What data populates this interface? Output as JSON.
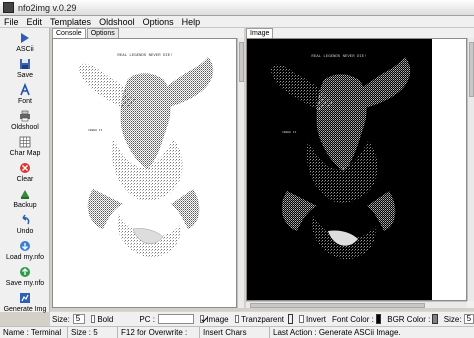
{
  "window": {
    "title": "nfo2img v.0.29"
  },
  "menu": [
    "File",
    "Edit",
    "Templates",
    "Oldshool",
    "Options",
    "Help"
  ],
  "tools": [
    {
      "label": "ASCii",
      "icon": "arrow-icon"
    },
    {
      "label": "Save",
      "icon": "floppy-icon"
    },
    {
      "label": "Font",
      "icon": "font-icon"
    },
    {
      "label": "Oldshool",
      "icon": "printer-icon"
    },
    {
      "label": "Char Map",
      "icon": "grid-icon"
    },
    {
      "label": "Clear",
      "icon": "clear-icon"
    },
    {
      "label": "Backup",
      "icon": "backup-icon"
    },
    {
      "label": "Undo",
      "icon": "undo-icon"
    },
    {
      "label": "Load my.nfo",
      "icon": "load-icon"
    },
    {
      "label": "Save my.nfo",
      "icon": "save-nfo-icon"
    },
    {
      "label": "Generate Img",
      "icon": "generate-icon"
    }
  ],
  "left_panel": {
    "tabs": [
      "Console",
      "Options"
    ],
    "active_tab": "Console",
    "art_title": "REAL LEGENDS NEVER DIE!",
    "art_tag": "CREED II"
  },
  "right_panel": {
    "tabs": [
      "Image"
    ],
    "active_tab": "Image",
    "art_title": "REAL LEGENDS NEVER DIE!",
    "art_tag": "CREED II"
  },
  "options_bar": {
    "size_label": "Size:",
    "size_value": "5",
    "bold_label": "Bold",
    "bold_checked": false,
    "pc_label": "PC :",
    "pc_value": "",
    "image_label": "Image",
    "image_checked": true,
    "transparent_label": "Tranzparent",
    "transparent_checked": false,
    "invert_label": "Invert",
    "invert_checked": false,
    "font_color_label": "Font Color :",
    "font_color": "#000000",
    "bgr_color_label": "BGR Color :",
    "bgr_color": "#808080",
    "size2_label": "Size:",
    "size2_value": "5"
  },
  "status": {
    "name_label": "Name :",
    "name_value": "Terminal",
    "size_label": "Size :",
    "size_value": "5",
    "hint": "F12 for Overwrite :",
    "mode": "Insert Chars",
    "last_action_label": "Last Action :",
    "last_action": "Generate ASCii Image."
  },
  "colors": {
    "console_bg": "#ffffff",
    "image_bg": "#000000",
    "face": "#d4d0c8"
  }
}
